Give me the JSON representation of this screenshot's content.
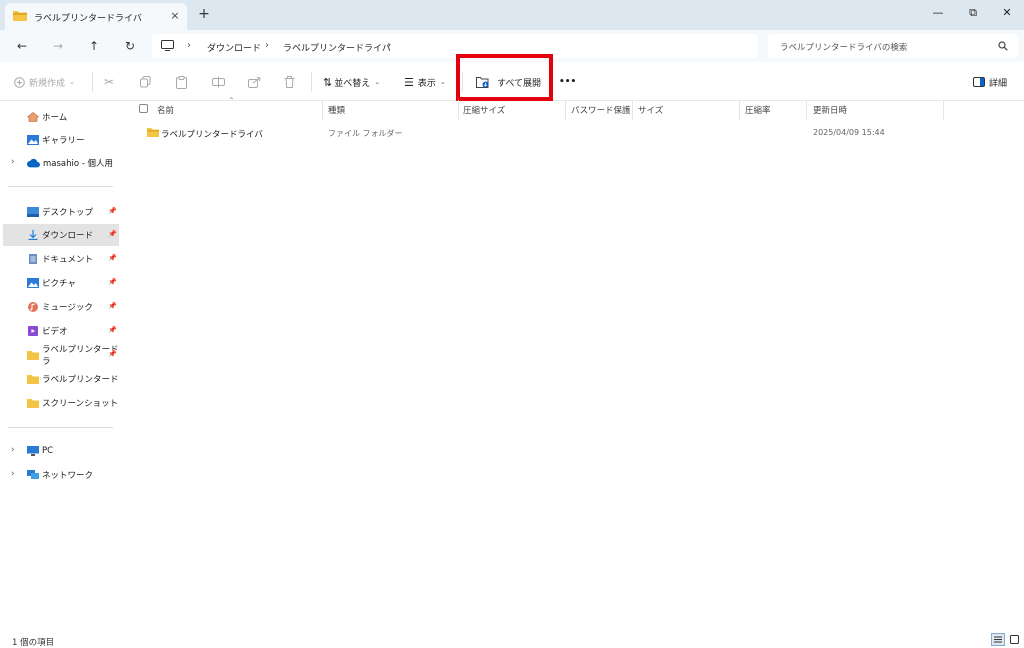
{
  "tab": {
    "title": "ラベルプリンタードライバ",
    "close": "×",
    "new_tab": "+"
  },
  "window": {
    "minimize": "—",
    "restore": "⧉",
    "close": "✕"
  },
  "nav": {
    "back": "←",
    "forward": "→",
    "up": "↑",
    "refresh": "↻"
  },
  "address": {
    "crumbs": [
      "ダウンロード",
      "ラベルプリンタードライバ"
    ],
    "separator": "›"
  },
  "search": {
    "placeholder": "ラベルプリンタードライバの検索"
  },
  "toolbar": {
    "new_label": "新規作成",
    "sort_label": "並べ替え",
    "view_label": "表示",
    "extract_all_label": "すべて展開",
    "more_label": "•••",
    "details_label": "詳細"
  },
  "sidebar": {
    "home": "ホーム",
    "gallery": "ギャラリー",
    "onedrive": "masahio - 個人用",
    "quick": [
      {
        "label": "デスクトップ"
      },
      {
        "label": "ダウンロード"
      },
      {
        "label": "ドキュメント"
      },
      {
        "label": "ピクチャ"
      },
      {
        "label": "ミュージック"
      },
      {
        "label": "ビデオ"
      },
      {
        "label": "ラベルプリンタードラ"
      },
      {
        "label": "ラベルプリンタードライバ"
      },
      {
        "label": "スクリーンショット"
      }
    ],
    "pc": "PC",
    "network": "ネットワーク"
  },
  "columns": {
    "name": "名前",
    "type": "種類",
    "compressed_size": "圧縮サイズ",
    "password": "パスワード保護",
    "size": "サイズ",
    "ratio": "圧縮率",
    "modified": "更新日時"
  },
  "files": [
    {
      "name": "ラベルプリンタードライバ",
      "type": "ファイル フォルダー",
      "modified": "2025/04/09 15:44"
    }
  ],
  "status": {
    "count": "1 個の項目"
  },
  "colors": {
    "highlight": "#e5000e",
    "folder": "#f4c443",
    "accent": "#0a64c8"
  }
}
